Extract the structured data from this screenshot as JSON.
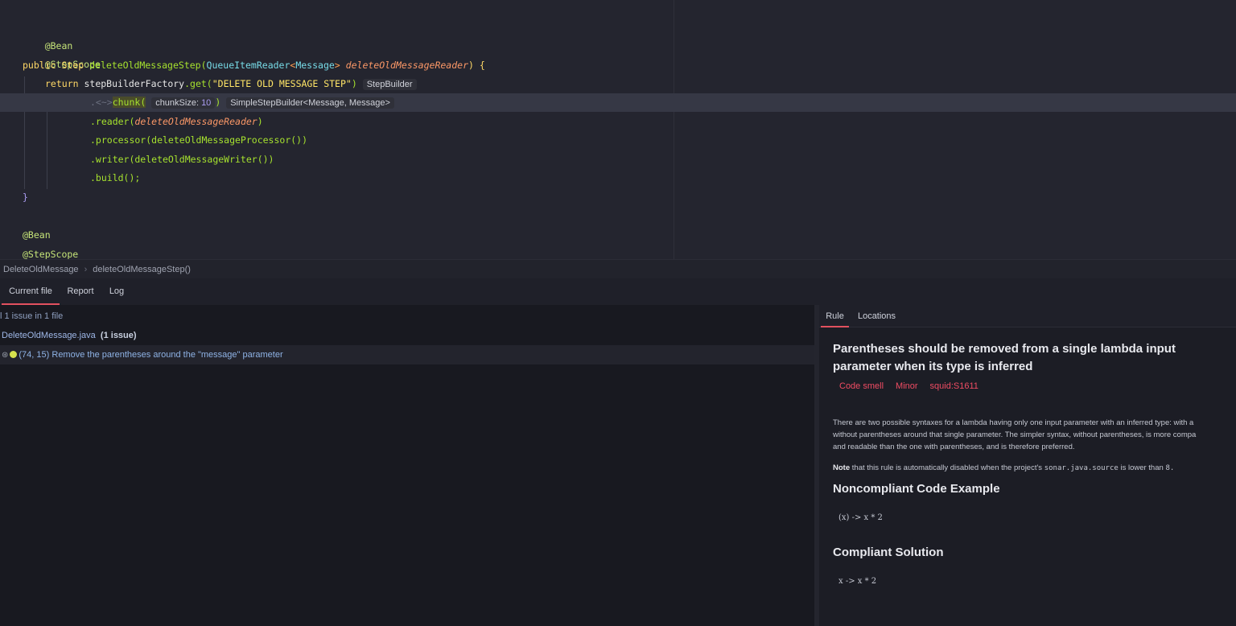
{
  "editor": {
    "lines": {
      "l1": "@Bean",
      "l2": "@StepScope",
      "l3_public": "public",
      "l3_step": "Step",
      "l3_method": "deleteOldMessageStep(",
      "l3_type": "QueueItemReader",
      "l3_generic_open": "<",
      "l3_generic": "Message",
      "l3_generic_close": ">",
      "l3_param": "deleteOldMessageReader",
      "l3_end": ") {",
      "l4_return": "return",
      "l4_call": "stepBuilderFactory",
      "l4_get": ".get(",
      "l4_str": "\"DELETE OLD MESSAGE STEP\"",
      "l4_close": ")",
      "l4_hint": "StepBuilder",
      "l5_marker": ".<~>",
      "l5_chunk": "chunk(",
      "l5_hint_label": "chunkSize:",
      "l5_hint_num": "10",
      "l5_close": ")",
      "l5_type_hint": "SimpleStepBuilder<Message, Message>",
      "l6_call": ".reader(",
      "l6_arg": "deleteOldMessageReader",
      "l6_close": ")",
      "l7": ".processor(deleteOldMessageProcessor())",
      "l8": ".writer(deleteOldMessageWriter())",
      "l9": ".build();",
      "l10": "}",
      "l11": "@Bean",
      "l12": "@StepScope"
    }
  },
  "breadcrumb": {
    "class_name": "DeleteOldMessage",
    "method_name": "deleteOldMessageStep()"
  },
  "tool_tabs": {
    "current_file": "Current file",
    "report": "Report",
    "log": "Log"
  },
  "issues": {
    "summary": "l 1 issue in 1 file",
    "file_name": "DeleteOldMessage.java",
    "file_count": "(1 issue)",
    "issue_location": "(74, 15)",
    "issue_message": "Remove the parentheses around the \"message\" parameter"
  },
  "rule_panel": {
    "tabs": {
      "rule": "Rule",
      "locations": "Locations"
    },
    "title": "Parentheses should be removed from a single lambda input parameter when its type is inferred",
    "tags": {
      "type": "Code smell",
      "severity": "Minor",
      "key": "squid:S1611"
    },
    "description_line1": "There are two possible syntaxes for a lambda having only one input parameter with an inferred type: with a",
    "description_line2": "without parentheses around that single parameter. The simpler syntax, without parentheses, is more compa",
    "description_line3": "and readable than the one with parentheses, and is therefore preferred.",
    "note_label": "Note",
    "note_text": "that this rule is automatically disabled when the project's",
    "note_code": "sonar.java.source",
    "note_tail": "is lower than",
    "note_version": "8.",
    "noncompliant_heading": "Noncompliant Code Example",
    "noncompliant_code": "(x) -> x * 2",
    "compliant_heading": "Compliant Solution",
    "compliant_code": "x -> x * 2"
  },
  "colors": {
    "accent": "#e2515f",
    "severity_dot": "#d6e24d",
    "tag_red": "#f04c63"
  },
  "icons": {
    "issue_type": "bug-icon",
    "severity": "severity-minor-icon"
  }
}
